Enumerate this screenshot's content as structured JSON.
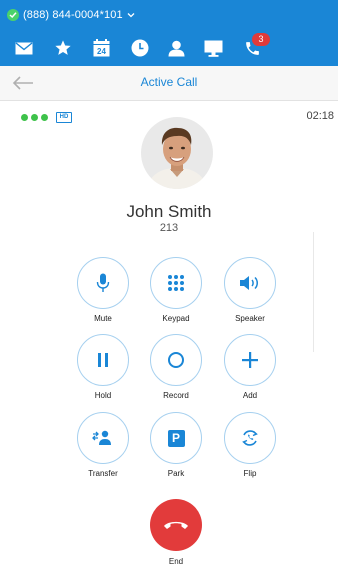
{
  "status_bar": {
    "phone_number": "(888) 844-0004*101"
  },
  "nav": {
    "items": [
      {
        "icon": "mail-icon"
      },
      {
        "icon": "star-icon"
      },
      {
        "icon": "calendar-icon",
        "day": "24"
      },
      {
        "icon": "clock-icon"
      },
      {
        "icon": "contact-icon"
      },
      {
        "icon": "monitor-icon"
      },
      {
        "icon": "phone-icon",
        "badge": "3"
      }
    ]
  },
  "header": {
    "title": "Active Call"
  },
  "call": {
    "quality_badge": "HD",
    "timer": "02:18",
    "caller_name": "John Smith",
    "caller_extension": "213"
  },
  "controls": {
    "mute": "Mute",
    "keypad": "Keypad",
    "speaker": "Speaker",
    "hold": "Hold",
    "record": "Record",
    "add": "Add",
    "transfer": "Transfer",
    "park": "Park",
    "park_glyph": "P",
    "flip": "Flip",
    "end": "End"
  },
  "colors": {
    "brand_blue": "#1a86d6",
    "end_red": "#e23b3b",
    "online_green": "#3ec24a",
    "badge_red": "#e03a3a"
  }
}
